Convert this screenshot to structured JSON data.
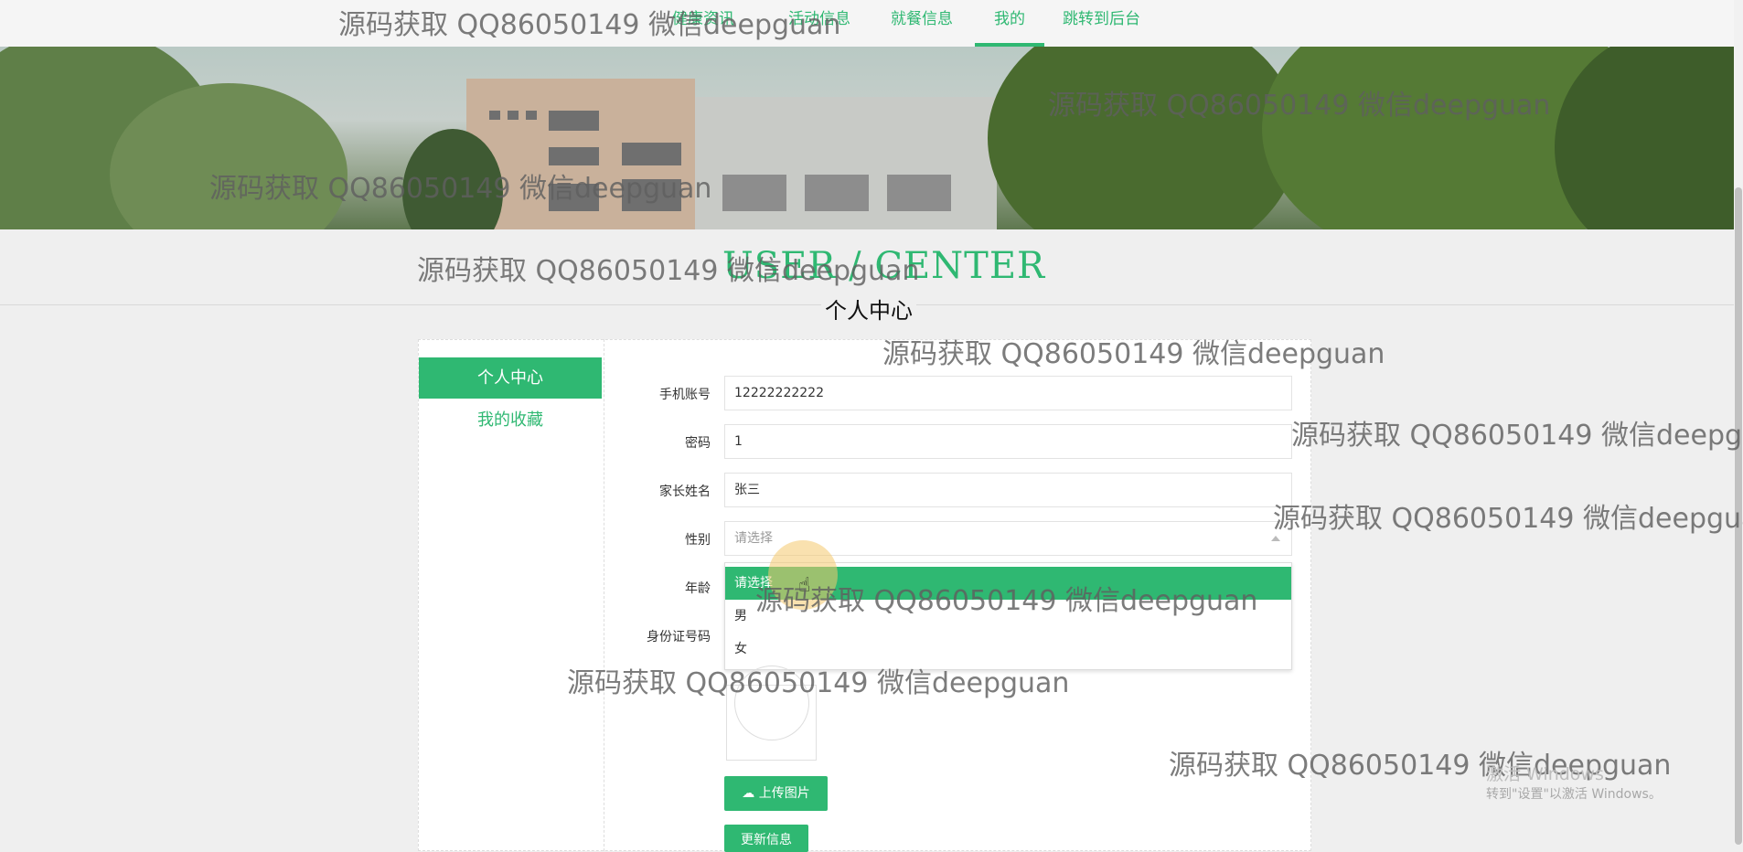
{
  "nav": {
    "items": [
      {
        "label": "健康资讯"
      },
      {
        "label": "活动信息"
      },
      {
        "label": "就餐信息"
      },
      {
        "label": "我的"
      },
      {
        "label": "跳转到后台"
      }
    ],
    "active": "我的"
  },
  "heading": {
    "title": "USER / CENTER",
    "subtitle": "个人中心"
  },
  "sidebar": {
    "items": [
      {
        "label": "个人中心"
      },
      {
        "label": "我的收藏"
      }
    ]
  },
  "form": {
    "phone": {
      "label": "手机账号",
      "value": "12222222222"
    },
    "password": {
      "label": "密码",
      "value": "1"
    },
    "parent_name": {
      "label": "家长姓名",
      "value": "张三"
    },
    "gender": {
      "label": "性别",
      "placeholder": "请选择"
    },
    "age": {
      "label": "年龄"
    },
    "id_number": {
      "label": "身份证号码"
    }
  },
  "gender_dropdown": {
    "options": [
      {
        "label": "请选择"
      },
      {
        "label": "男"
      },
      {
        "label": "女"
      }
    ]
  },
  "buttons": {
    "upload": "上传图片",
    "update": "更新信息"
  },
  "watermark": "源码获取 QQ86050149 微信deepguan",
  "os_notice": {
    "line1": "激活 Windows",
    "line2": "转到\"设置\"以激活 Windows。"
  },
  "colors": {
    "accent": "#2fb872",
    "page_bg": "#efefef"
  }
}
